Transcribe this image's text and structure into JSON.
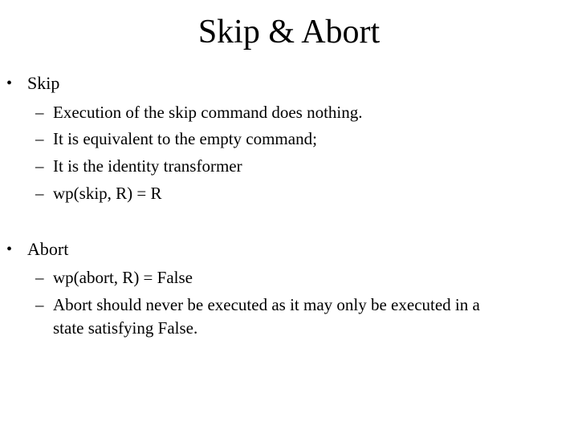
{
  "slide": {
    "title": "Skip & Abort",
    "bullet_glyph": "•",
    "dash_glyph": "–",
    "sections": [
      {
        "label": "Skip",
        "items": [
          "Execution of the skip command does nothing.",
          "It is equivalent to the empty command;",
          "It is the identity transformer",
          "wp(skip, R) = R"
        ]
      },
      {
        "label": "Abort",
        "items": [
          "wp(abort, R) = False",
          "Abort should never be executed as it may only be executed in a",
          "state satisfying False."
        ]
      }
    ]
  }
}
